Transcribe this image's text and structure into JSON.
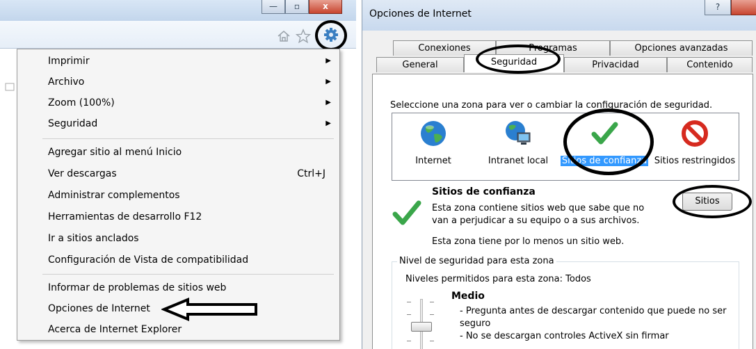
{
  "left_panel": {
    "window_buttons": [
      "—",
      "▫",
      "x"
    ],
    "toolbar_icons": [
      "home-icon",
      "star-icon",
      "gear-icon"
    ],
    "menu_items": [
      {
        "label": "Imprimir",
        "submenu": true
      },
      {
        "label": "Archivo",
        "submenu": true
      },
      {
        "label": "Zoom (100%)",
        "submenu": true
      },
      {
        "label": "Seguridad",
        "submenu": true
      },
      {
        "label": "Agregar sitio al menú Inicio"
      },
      {
        "label": "Ver descargas",
        "shortcut": "Ctrl+J"
      },
      {
        "label": "Administrar complementos"
      },
      {
        "label": "Herramientas de desarrollo F12"
      },
      {
        "label": "Ir a sitios anclados"
      },
      {
        "label": "Configuración de Vista de compatibilidad"
      },
      {
        "label": "Informar de problemas de sitios web"
      },
      {
        "label": "Opciones de Internet"
      },
      {
        "label": "Acerca de Internet Explorer"
      }
    ]
  },
  "dialog": {
    "title": "Opciones de Internet",
    "help_label": "?",
    "tabs_back": [
      "Conexiones",
      "Programas",
      "Opciones avanzadas"
    ],
    "tabs_front": [
      "General",
      "Seguridad",
      "Privacidad",
      "Contenido"
    ],
    "active_tab": "Seguridad",
    "instruction": "Seleccione una zona para ver o cambiar la configuración de seguridad.",
    "zones": [
      {
        "label": "Internet",
        "icon": "globe-icon"
      },
      {
        "label": "Intranet local",
        "icon": "intranet-icon"
      },
      {
        "label": "Sitios de confianza",
        "icon": "checkmark-icon",
        "selected": true
      },
      {
        "label": "Sitios restringidos",
        "icon": "prohibited-icon"
      }
    ],
    "zone_title": "Sitios de confianza",
    "zone_desc_line1": "Esta zona contiene sitios web que sabe que no",
    "zone_desc_line2": "van a perjudicar a su equipo o a sus archivos.",
    "zone_note": "Esta zona tiene por lo menos un sitio web.",
    "sites_button": "Sitios",
    "level_group_label": "Nivel de seguridad para esta zona",
    "allowed_levels": "Niveles permitidos para esta zona: Todos",
    "level_name": "Medio",
    "level_bullets": [
      "- Pregunta antes de descargar contenido que puede no ser",
      "seguro",
      "- No se descargan controles ActiveX sin firmar"
    ],
    "colors": {
      "selection": "#3399ff",
      "check_green": "#3aa64a",
      "restricted_red": "#d62a1f",
      "annotation": "#000000"
    }
  }
}
